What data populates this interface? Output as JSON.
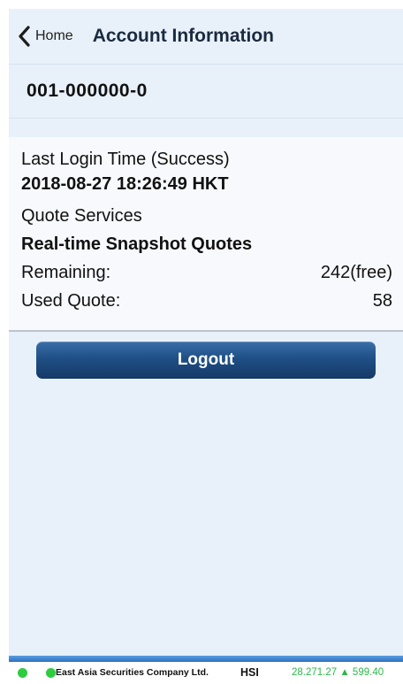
{
  "navbar": {
    "back_label": "Home",
    "title": "Account Information"
  },
  "account": {
    "number": "001-000000-0"
  },
  "info": {
    "last_login_label": "Last Login Time (Success)",
    "last_login_value": "2018-08-27 18:26:49 HKT",
    "quote_services_label": "Quote Services",
    "quote_services_value": "Real-time Snapshot Quotes",
    "remaining_label": "Remaining:",
    "remaining_value": "242(free)",
    "used_quote_label": "Used Quote:",
    "used_quote_value": "58"
  },
  "actions": {
    "logout_label": "Logout"
  },
  "ticker": {
    "company": "East Asia Securities Company Ltd.",
    "index_name": "HSI",
    "index_value": "28.271.27 ▲ 599.40",
    "status_color": "#2ecc40",
    "up_color": "#2db84b"
  },
  "colors": {
    "nav_background": "#e8f1fa",
    "button_top": "#3b6fa8",
    "button_bottom": "#153a66"
  },
  "icons": {
    "back": "chevron-left-icon",
    "status": "status-dot-icon"
  }
}
